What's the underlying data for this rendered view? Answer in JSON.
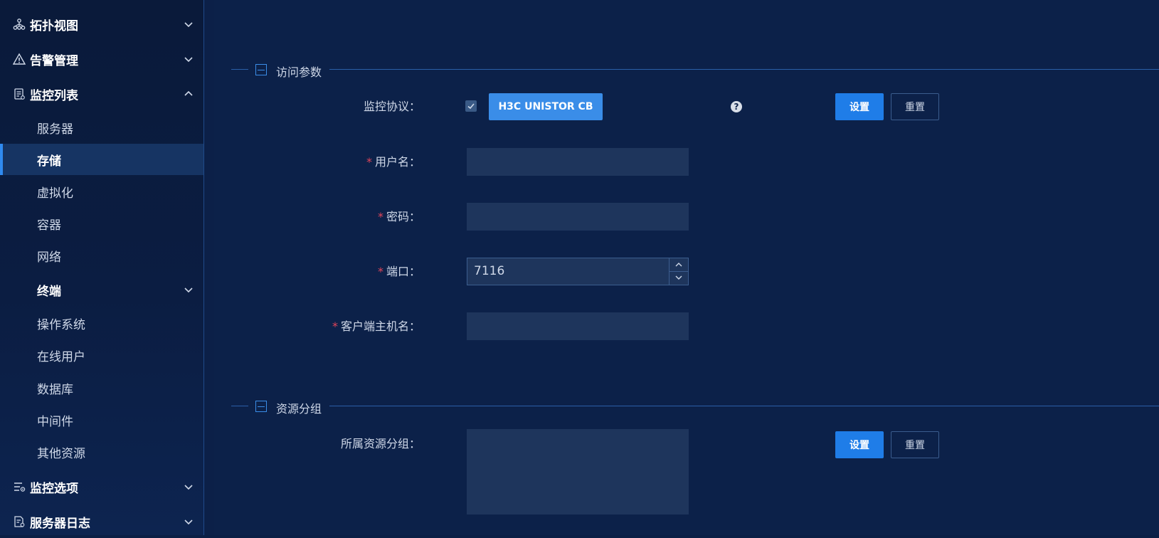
{
  "sidebar": {
    "groups": {
      "topology": {
        "label": "拓扑视图",
        "icon": "topology-icon"
      },
      "alarm": {
        "label": "告警管理",
        "icon": "warning-icon"
      },
      "monitor_list": {
        "label": "监控列表",
        "icon": "list-icon"
      },
      "monitor_options": {
        "label": "监控选项",
        "icon": "options-icon"
      },
      "server_log": {
        "label": "服务器日志",
        "icon": "log-icon"
      }
    },
    "items": {
      "server": "服务器",
      "storage": "存储",
      "virtualization": "虚拟化",
      "container": "容器",
      "network": "网络",
      "terminal": "终端",
      "os": "操作系统",
      "online_users": "在线用户",
      "database": "数据库",
      "middleware": "中间件",
      "other": "其他资源"
    },
    "active": "存储"
  },
  "sections": {
    "access": {
      "title": "访问参数",
      "protocol_label": "监控协议：",
      "protocol_value": "H3C UNISTOR CB",
      "protocol_checked": true,
      "username_label": "用户名：",
      "password_label": "密码：",
      "port_label": "端口：",
      "port_value": "7116",
      "hostname_label": "客户端主机名：",
      "required_mark": "*",
      "help_mark": "?",
      "set_label": "设置",
      "reset_label": "重置"
    },
    "resource_group": {
      "title": "资源分组",
      "group_label": "所属资源分组：",
      "set_label": "设置",
      "reset_label": "重置"
    }
  },
  "colors": {
    "accent": "#1f7de8",
    "required": "#e0455a",
    "background": "#0c2149"
  }
}
